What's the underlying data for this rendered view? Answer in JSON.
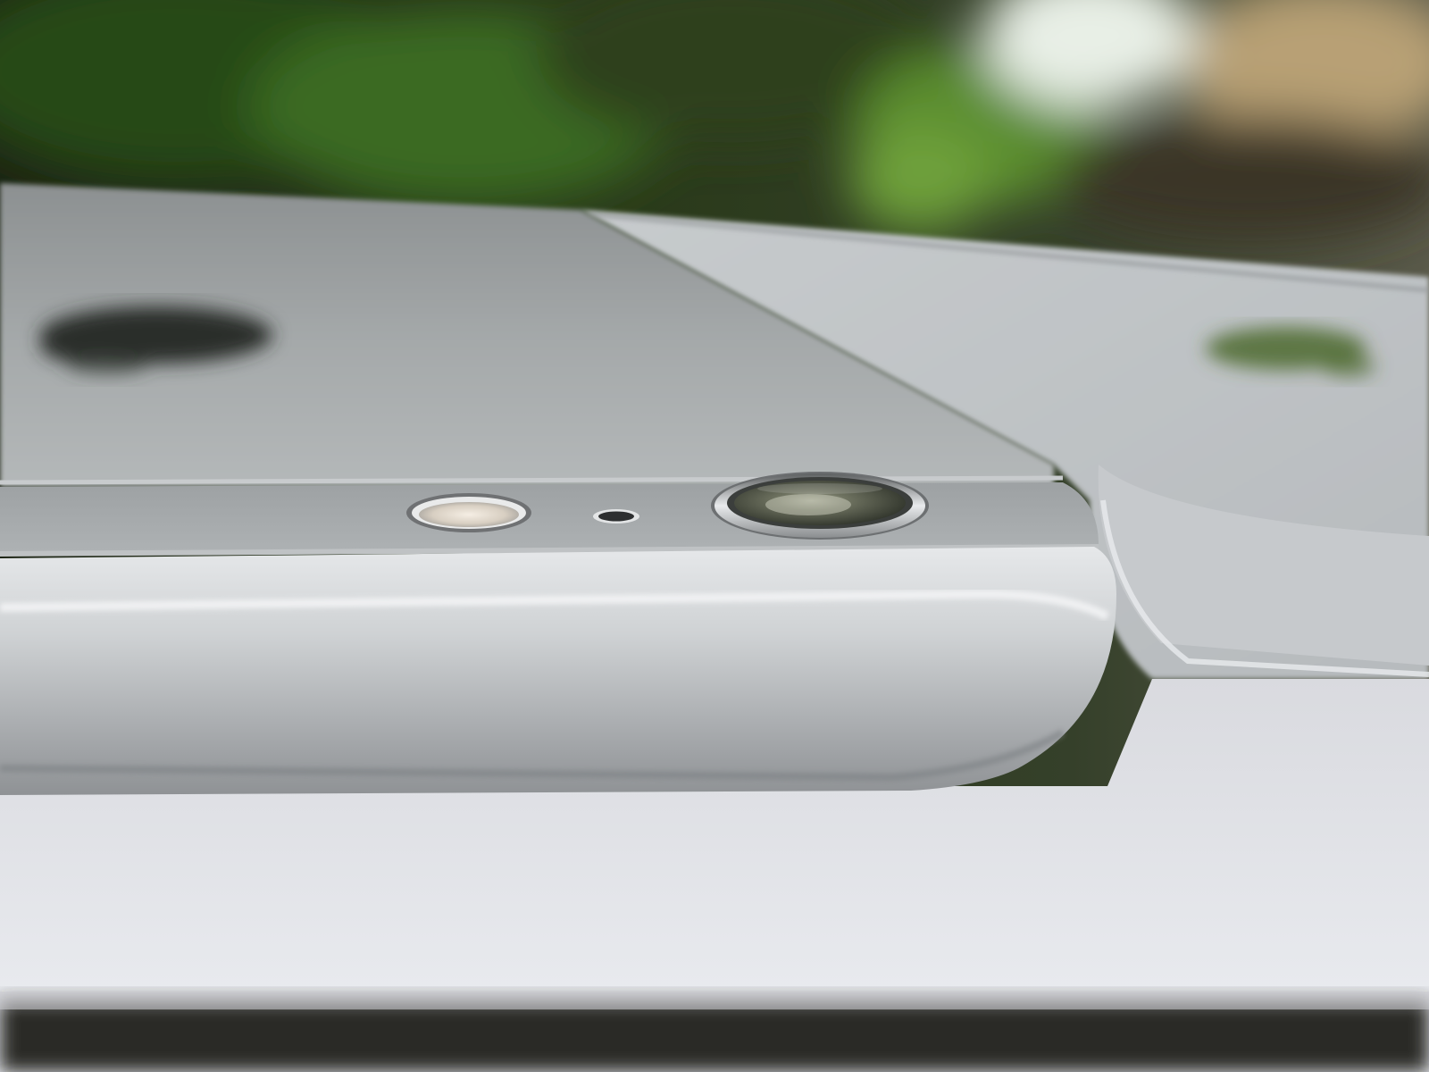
{
  "scene": {
    "subject": "phone-camera-closeup",
    "colors": {
      "foliage_dark": "#1f2a14",
      "foliage_green": "#4e7a2a",
      "bright_window": "#e9efe4",
      "aluminum_light": "#d4d6d8",
      "aluminum_mid": "#a9adb0",
      "aluminum_dark": "#7f8386",
      "logo": "#2b2d2a",
      "box_white": "#e8e8ec",
      "lens_glass": "#4a4f45"
    },
    "icons": [
      "apple-logo-icon",
      "camera-lens-icon",
      "flash-icon",
      "microphone-hole-icon"
    ]
  }
}
